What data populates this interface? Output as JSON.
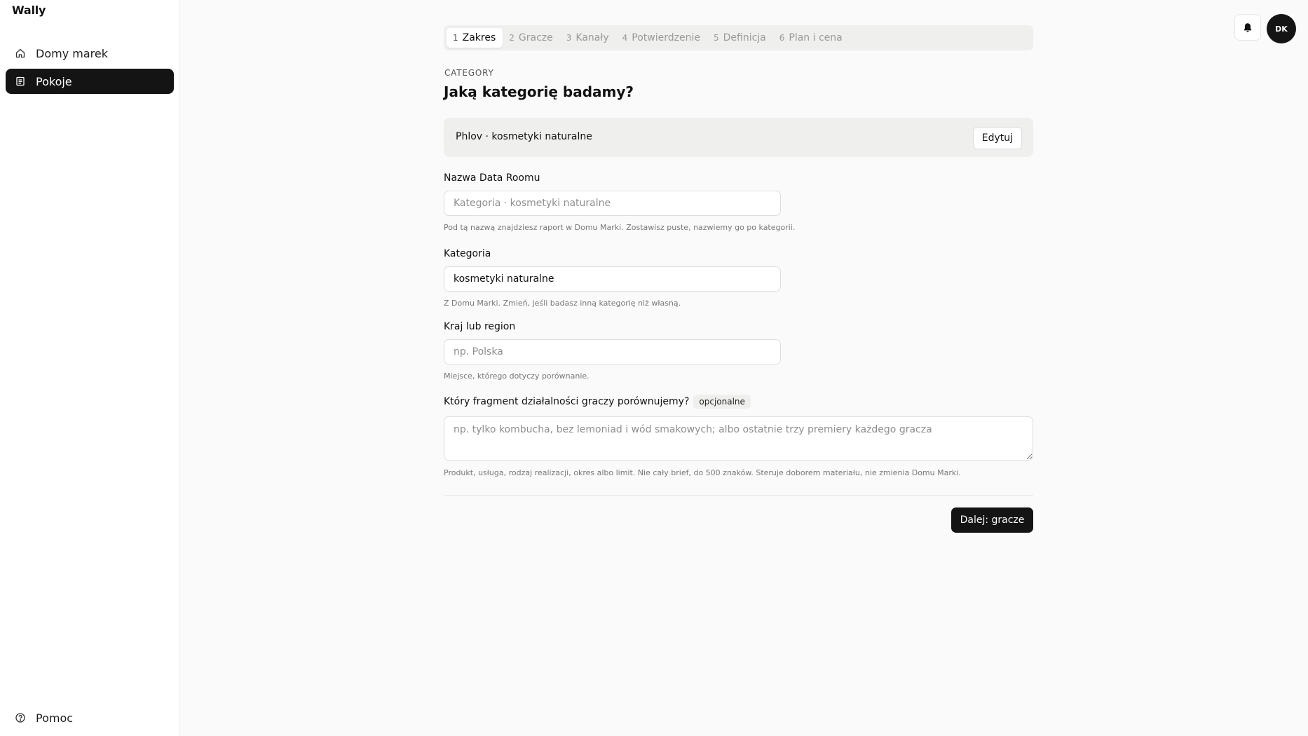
{
  "app": {
    "brand": "Wally"
  },
  "sidebar": {
    "items": [
      {
        "label": "Domy marek",
        "icon": "home-icon",
        "active": false
      },
      {
        "label": "Pokoje",
        "icon": "document-icon",
        "active": true
      }
    ],
    "footer": {
      "label": "Pomoc",
      "icon": "help-circle-icon"
    }
  },
  "stepper": {
    "steps": [
      {
        "num": "1",
        "label": "Zakres",
        "active": true
      },
      {
        "num": "2",
        "label": "Gracze",
        "active": false
      },
      {
        "num": "3",
        "label": "Kanały",
        "active": false
      },
      {
        "num": "4",
        "label": "Potwierdzenie",
        "active": false
      },
      {
        "num": "5",
        "label": "Definicja",
        "active": false
      },
      {
        "num": "6",
        "label": "Plan i cena",
        "active": false
      }
    ]
  },
  "section": {
    "eyebrow": "CATEGORY",
    "title": "Jaką kategorię badamy?"
  },
  "brand_card": {
    "text": "Phlov · kosmetyki naturalne",
    "edit_label": "Edytuj"
  },
  "form": {
    "name": {
      "label": "Nazwa Data Roomu",
      "value": "",
      "placeholder": "Kategoria · kosmetyki naturalne",
      "hint": "Pod tą nazwą znajdziesz raport w Domu Marki. Zostawisz puste, nazwiemy go po kategorii."
    },
    "category": {
      "label": "Kategoria",
      "value": "kosmetyki naturalne",
      "hint": "Z Domu Marki. Zmień, jeśli badasz inną kategorię niż własną."
    },
    "region": {
      "label": "Kraj lub region",
      "value": "",
      "placeholder": "np. Polska",
      "hint": "Miejsce, którego dotyczy porównanie."
    },
    "scope": {
      "label": "Który fragment działalności graczy porównujemy?",
      "badge": "opcjonalne",
      "value": "",
      "placeholder": "np. tylko kombucha, bez lemoniad i wód smakowych; albo ostatnie trzy premiery każdego gracza",
      "hint": "Produkt, usługa, rodzaj realizacji, okres albo limit. Nie cały brief, do 500 znaków. Steruje doborem materiału, nie zmienia Domu Marki."
    }
  },
  "actions": {
    "next_label": "Dalej: gracze"
  },
  "topbar": {
    "avatar_initials": "DK",
    "bell_icon": "bell-icon"
  },
  "colors": {
    "accent": "#141414",
    "surface": "#efefee",
    "background": "#fafafa"
  }
}
